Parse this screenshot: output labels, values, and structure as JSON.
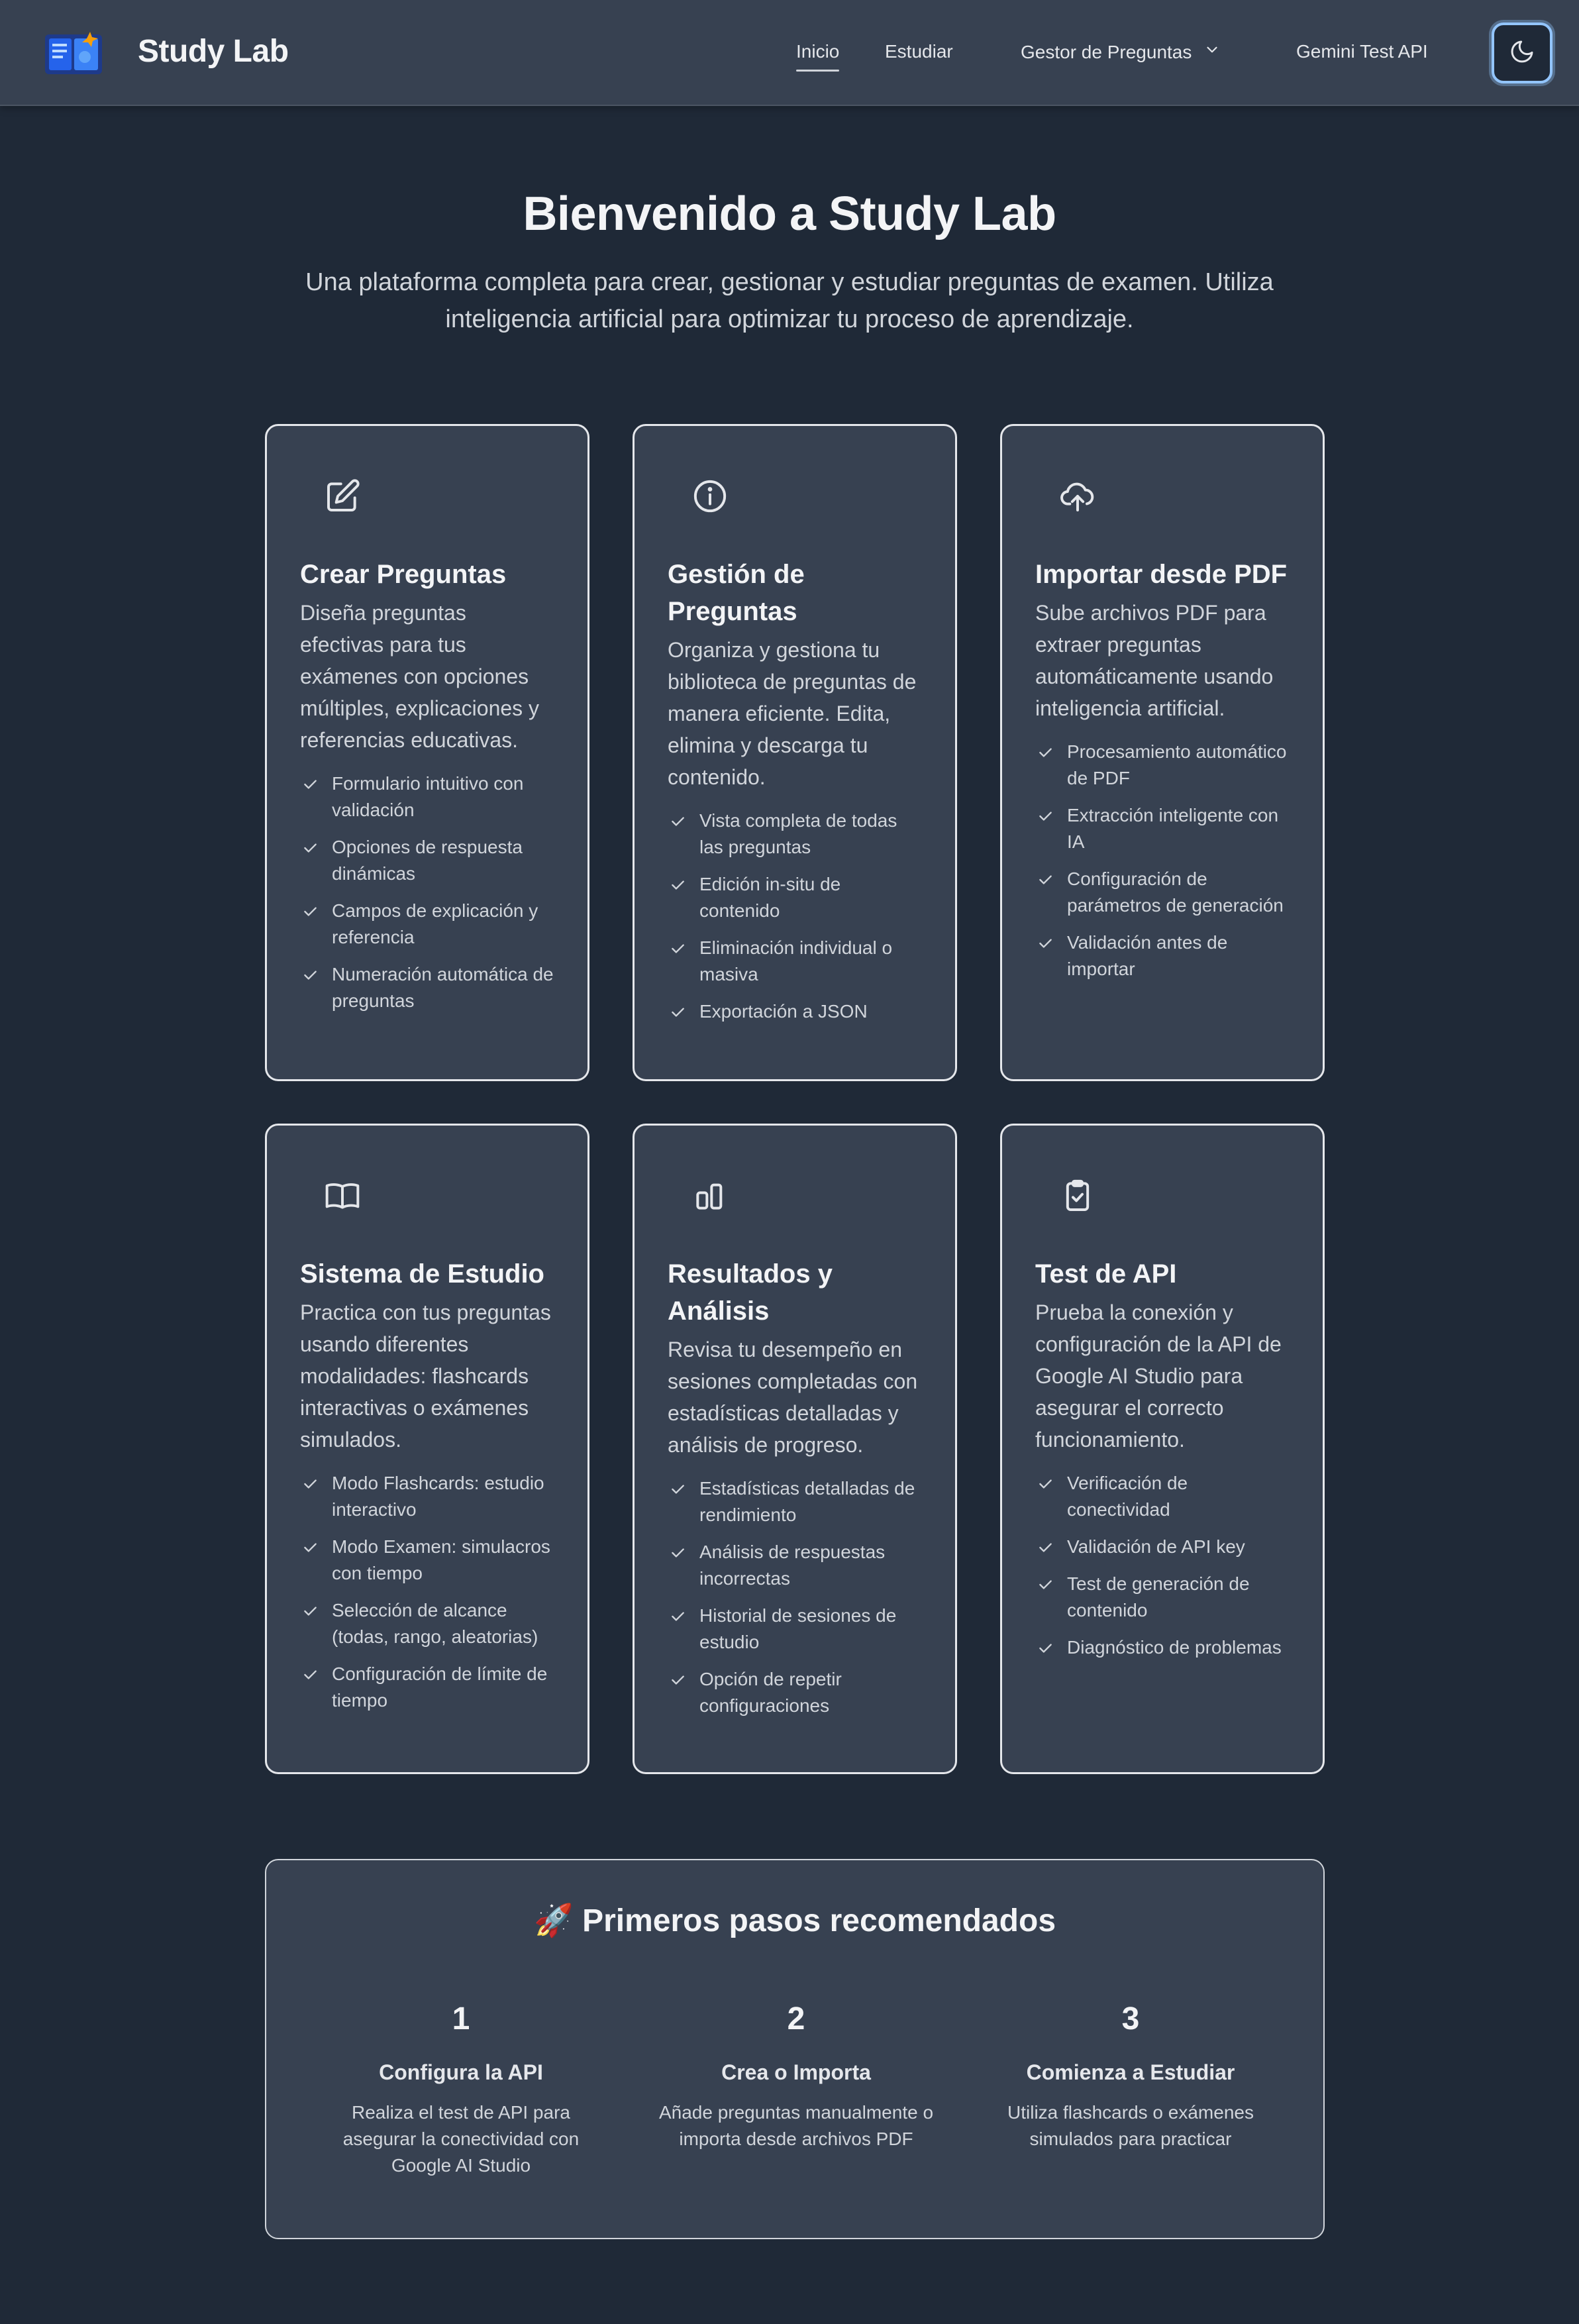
{
  "header": {
    "brand": "Study Lab",
    "nav": {
      "inicio": "Inicio",
      "estudiar": "Estudiar",
      "gestor": "Gestor de Preguntas",
      "gemini": "Gemini Test API"
    },
    "theme_toggle_icon": "moon-icon"
  },
  "hero": {
    "title": "Bienvenido a Study Lab",
    "subtitle": "Una plataforma completa para crear, gestionar y estudiar preguntas de examen. Utiliza inteligencia artificial para optimizar tu proceso de aprendizaje."
  },
  "cards": [
    {
      "icon": "edit-icon",
      "title": "Crear Preguntas",
      "desc": "Diseña preguntas efectivas para tus exámenes con opciones múltiples, explicaciones y referencias educativas.",
      "items": [
        "Formulario intuitivo con validación",
        "Opciones de respuesta dinámicas",
        "Campos de explicación y referencia",
        "Numeración automática de preguntas"
      ]
    },
    {
      "icon": "info-icon",
      "title": "Gestión de Preguntas",
      "desc": "Organiza y gestiona tu biblioteca de preguntas de manera eficiente. Edita, elimina y descarga tu contenido.",
      "items": [
        "Vista completa de todas las preguntas",
        "Edición in-situ de contenido",
        "Eliminación individual o masiva",
        "Exportación a JSON"
      ]
    },
    {
      "icon": "cloud-upload-icon",
      "title": "Importar desde PDF",
      "desc": "Sube archivos PDF para extraer preguntas automáticamente usando inteligencia artificial.",
      "items": [
        "Procesamiento automático de PDF",
        "Extracción inteligente con IA",
        "Configuración de parámetros de generación",
        "Validación antes de importar"
      ]
    },
    {
      "icon": "book-icon",
      "title": "Sistema de Estudio",
      "desc": "Practica con tus preguntas usando diferentes modalidades: flashcards interactivas o exámenes simulados.",
      "items": [
        "Modo Flashcards: estudio interactivo",
        "Modo Examen: simulacros con tiempo",
        "Selección de alcance (todas, rango, aleatorias)",
        "Configuración de límite de tiempo"
      ]
    },
    {
      "icon": "bar-chart-icon",
      "title": "Resultados y Análisis",
      "desc": "Revisa tu desempeño en sesiones completadas con estadísticas detalladas y análisis de progreso.",
      "items": [
        "Estadísticas detalladas de rendimiento",
        "Análisis de respuestas incorrectas",
        "Historial de sesiones de estudio",
        "Opción de repetir configuraciones"
      ]
    },
    {
      "icon": "clipboard-check-icon",
      "title": "Test de API",
      "desc": "Prueba la conexión y configuración de la API de Google AI Studio para asegurar el correcto funcionamiento.",
      "items": [
        "Verificación de conectividad",
        "Validación de API key",
        "Test de generación de contenido",
        "Diagnóstico de problemas"
      ]
    }
  ],
  "steps": {
    "title": "🚀 Primeros pasos recomendados",
    "items": [
      {
        "num": "1",
        "title": "Configura la API",
        "desc": "Realiza el test de API para asegurar la conectividad con Google AI Studio"
      },
      {
        "num": "2",
        "title": "Crea o Importa",
        "desc": "Añade preguntas manualmente o importa desde archivos PDF"
      },
      {
        "num": "3",
        "title": "Comienza a Estudiar",
        "desc": "Utiliza flashcards o exámenes simulados para practicar"
      }
    ]
  },
  "colors": {
    "background": "#1f2937",
    "surface": "#374151",
    "focus_ring": "#93c5fd"
  }
}
